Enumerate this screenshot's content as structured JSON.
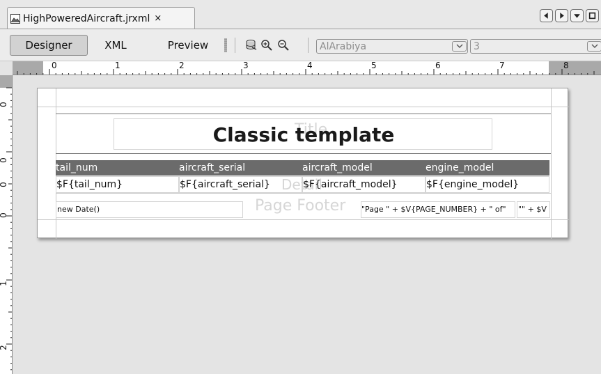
{
  "tab": {
    "title": "HighPoweredAircraft.jrxml",
    "close_label": "×"
  },
  "tab_nav": {
    "icons": [
      "scroll-left-icon",
      "scroll-right-icon",
      "tab-list-icon",
      "maximize-icon"
    ]
  },
  "toolbar": {
    "designer_label": "Designer",
    "xml_label": "XML",
    "preview_label": "Preview",
    "icons": [
      "database-icon",
      "zoom-in-icon",
      "zoom-out-icon"
    ],
    "font_name": "AlArabiya",
    "font_size": "3"
  },
  "ruler": {
    "horizontal_numbers": [
      "0",
      "1",
      "2",
      "3",
      "4",
      "5",
      "6",
      "7",
      "8"
    ],
    "vertical_numbers": [
      "0",
      "0",
      "0",
      "0",
      "1",
      "2"
    ]
  },
  "report": {
    "title_text": "Classic template",
    "bands": {
      "title": "Title",
      "detail": "Detail",
      "page_footer": "Page Footer"
    },
    "column_headers": [
      "tail_num",
      "aircraft_serial",
      "aircraft_model",
      "engine_model"
    ],
    "detail_fields": [
      "$F{tail_num}",
      "$F{aircraft_serial}",
      "$F{aircraft_model}",
      "$F{engine_model}"
    ],
    "page_footer": {
      "date_expression": "new Date()",
      "page_expression": "\"Page \" + $V{PAGE_NUMBER} + \" of\"",
      "total_expression": "\"\" + $V"
    }
  },
  "colors": {
    "column_header_bg": "#6b6b6b",
    "column_header_text": "#ffffff",
    "band_label": "#d6d6d6",
    "page_bg": "#ffffff"
  }
}
